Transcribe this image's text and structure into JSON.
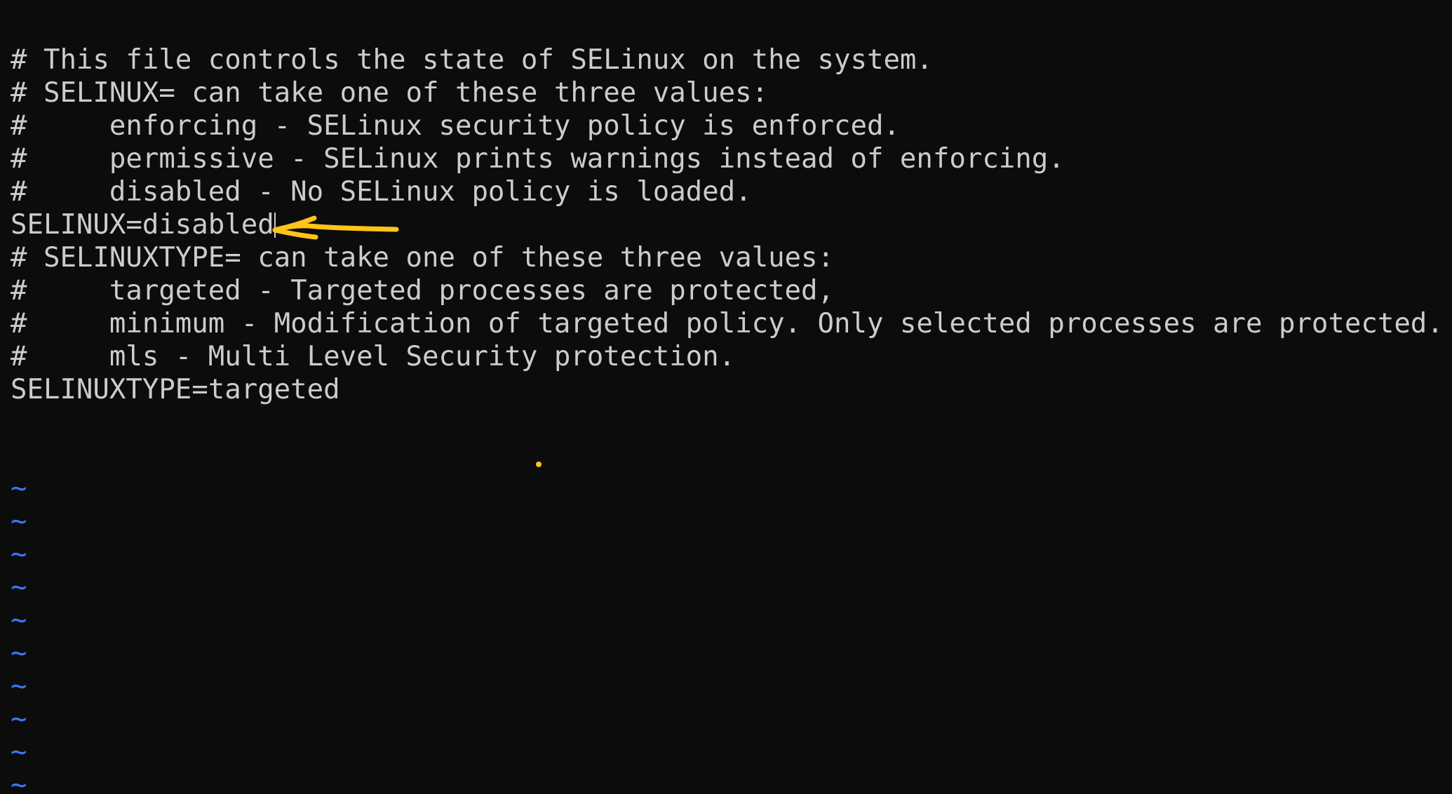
{
  "editor": {
    "lines": [
      "# This file controls the state of SELinux on the system.",
      "# SELINUX= can take one of these three values:",
      "#     enforcing - SELinux security policy is enforced.",
      "#     permissive - SELinux prints warnings instead of enforcing.",
      "#     disabled - No SELinux policy is loaded.",
      "SELINUX=disabled",
      "# SELINUXTYPE= can take one of these three values:",
      "#     targeted - Targeted processes are protected,",
      "#     minimum - Modification of targeted policy. Only selected processes are protected.",
      "#     mls - Multi Level Security protection.",
      "SELINUXTYPE=targeted"
    ],
    "empty_line_marker": "~",
    "colors": {
      "background": "#0c0c0c",
      "text": "#cccccc",
      "tilde": "#3b78ff",
      "annotation": "#ffc419"
    }
  },
  "annotation": {
    "shape": "arrow",
    "points_to": "SELINUX=disabled"
  }
}
